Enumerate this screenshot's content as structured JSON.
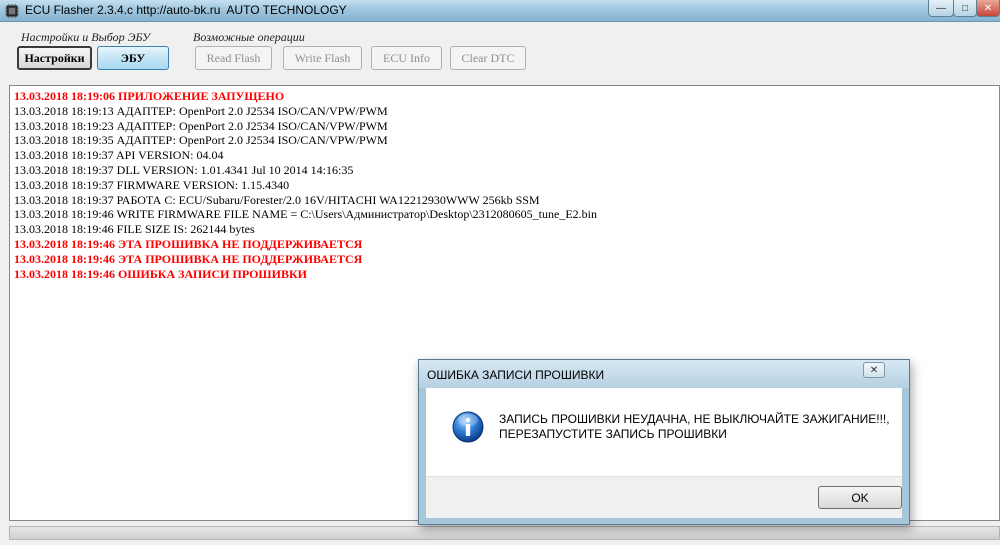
{
  "window": {
    "title": "ECU Flasher 2.3.4.c http://auto-bk.ru  AUTO TECHNOLOGY",
    "minimize_glyph": "—",
    "maximize_glyph": "□",
    "close_glyph": "✕"
  },
  "toolbar": {
    "group1_label": "Настройки и Выбор ЭБУ",
    "group2_label": "Возможные операции",
    "settings_label": "Настройки",
    "ecu_label": "ЭБУ",
    "read_flash_label": "Read Flash",
    "write_flash_label": "Write Flash",
    "ecu_info_label": "ECU Info",
    "clear_dtc_label": "Clear DTC"
  },
  "log": [
    {
      "text": "13.03.2018 18:19:06 ПРИЛОЖЕНИЕ ЗАПУЩЕНО",
      "error": true
    },
    {
      "text": "13.03.2018 18:19:13 АДАПТЕР: OpenPort 2.0 J2534 ISO/CAN/VPW/PWM",
      "error": false
    },
    {
      "text": "13.03.2018 18:19:23 АДАПТЕР: OpenPort 2.0 J2534 ISO/CAN/VPW/PWM",
      "error": false
    },
    {
      "text": "13.03.2018 18:19:35 АДАПТЕР: OpenPort 2.0 J2534 ISO/CAN/VPW/PWM",
      "error": false
    },
    {
      "text": "13.03.2018 18:19:37 API VERSION: 04.04",
      "error": false
    },
    {
      "text": "13.03.2018 18:19:37 DLL VERSION: 1.01.4341 Jul 10 2014 14:16:35",
      "error": false
    },
    {
      "text": "13.03.2018 18:19:37 FIRMWARE VERSION: 1.15.4340",
      "error": false
    },
    {
      "text": "13.03.2018 18:19:37 РАБОТА С: ECU/Subaru/Forester/2.0 16V/HITACHI WA12212930WWW 256kb SSM",
      "error": false
    },
    {
      "text": "13.03.2018 18:19:46 WRITE FIRMWARE FILE NAME = C:\\Users\\Администратор\\Desktop\\2312080605_tune_E2.bin",
      "error": false
    },
    {
      "text": "13.03.2018 18:19:46 FILE SIZE IS: 262144 bytes",
      "error": false
    },
    {
      "text": "13.03.2018 18:19:46 ЭТА ПРОШИВКА НЕ ПОДДЕРЖИВАЕТСЯ",
      "error": true
    },
    {
      "text": "13.03.2018 18:19:46 ЭТА ПРОШИВКА НЕ ПОДДЕРЖИВАЕТСЯ",
      "error": true
    },
    {
      "text": "13.03.2018 18:19:46 ОШИБКА ЗАПИСИ ПРОШИВКИ",
      "error": true
    }
  ],
  "dialog": {
    "title": "ОШИБКА ЗАПИСИ ПРОШИВКИ",
    "close_glyph": "✕",
    "message_line1": "ЗАПИСЬ ПРОШИВКИ НЕУДАЧНА, НЕ ВЫКЛЮЧАЙТЕ ЗАЖИГАНИЕ!!!,",
    "message_line2": "ПЕРЕЗАПУСТИТЕ ЗАПИСЬ ПРОШИВКИ",
    "ok_label": "OK"
  },
  "icons": {
    "app": "app-chip-icon",
    "dialog": "info-icon"
  },
  "colors": {
    "error_text": "#ff0000",
    "info_icon": "#1f62b8"
  }
}
